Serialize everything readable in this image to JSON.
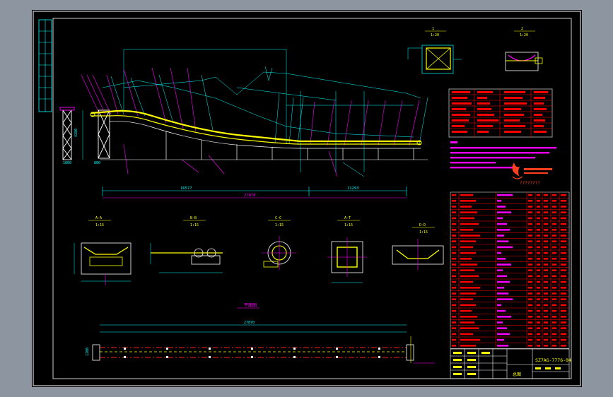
{
  "colors": {
    "viewport_bg": "#8c95a0",
    "sheet_bg": "#000000",
    "border": "#ffffff",
    "dim_cyan": "#00ffff",
    "belt_yellow": "#ffff00",
    "structure_white": "#ffffff",
    "leader_magenta": "#ff00ff",
    "hidden_red": "#ff2020",
    "table_red": "#ff0000",
    "grid_green": "#00ff00"
  },
  "dimensions": {
    "total_length": "27870",
    "left_segment": "16577",
    "right_segment": "11293",
    "height": "4280",
    "left_base": "1600",
    "left_base_2": "800",
    "plan_width": "1200",
    "plan_total": "27870"
  },
  "views": {
    "view_1": {
      "label": "A-A",
      "scale": "1:15"
    },
    "view_2": {
      "label": "B-B",
      "scale": "1:15"
    },
    "view_3": {
      "label": "C-C",
      "scale": "1:15"
    },
    "view_4": {
      "label": "A-T",
      "scale": "1:15"
    },
    "view_5": {
      "label": "D-D",
      "scale": "1:15"
    },
    "top_detail_1": {
      "label": "1",
      "scale": "1:20"
    },
    "top_detail_2": {
      "label": "2",
      "scale": "1:20"
    },
    "plan_view": {
      "label": "平面图"
    }
  },
  "logo": {
    "caption": "????????"
  },
  "title_block": {
    "drawing_number": "SZ7AG-7776-04",
    "name": "总图"
  }
}
